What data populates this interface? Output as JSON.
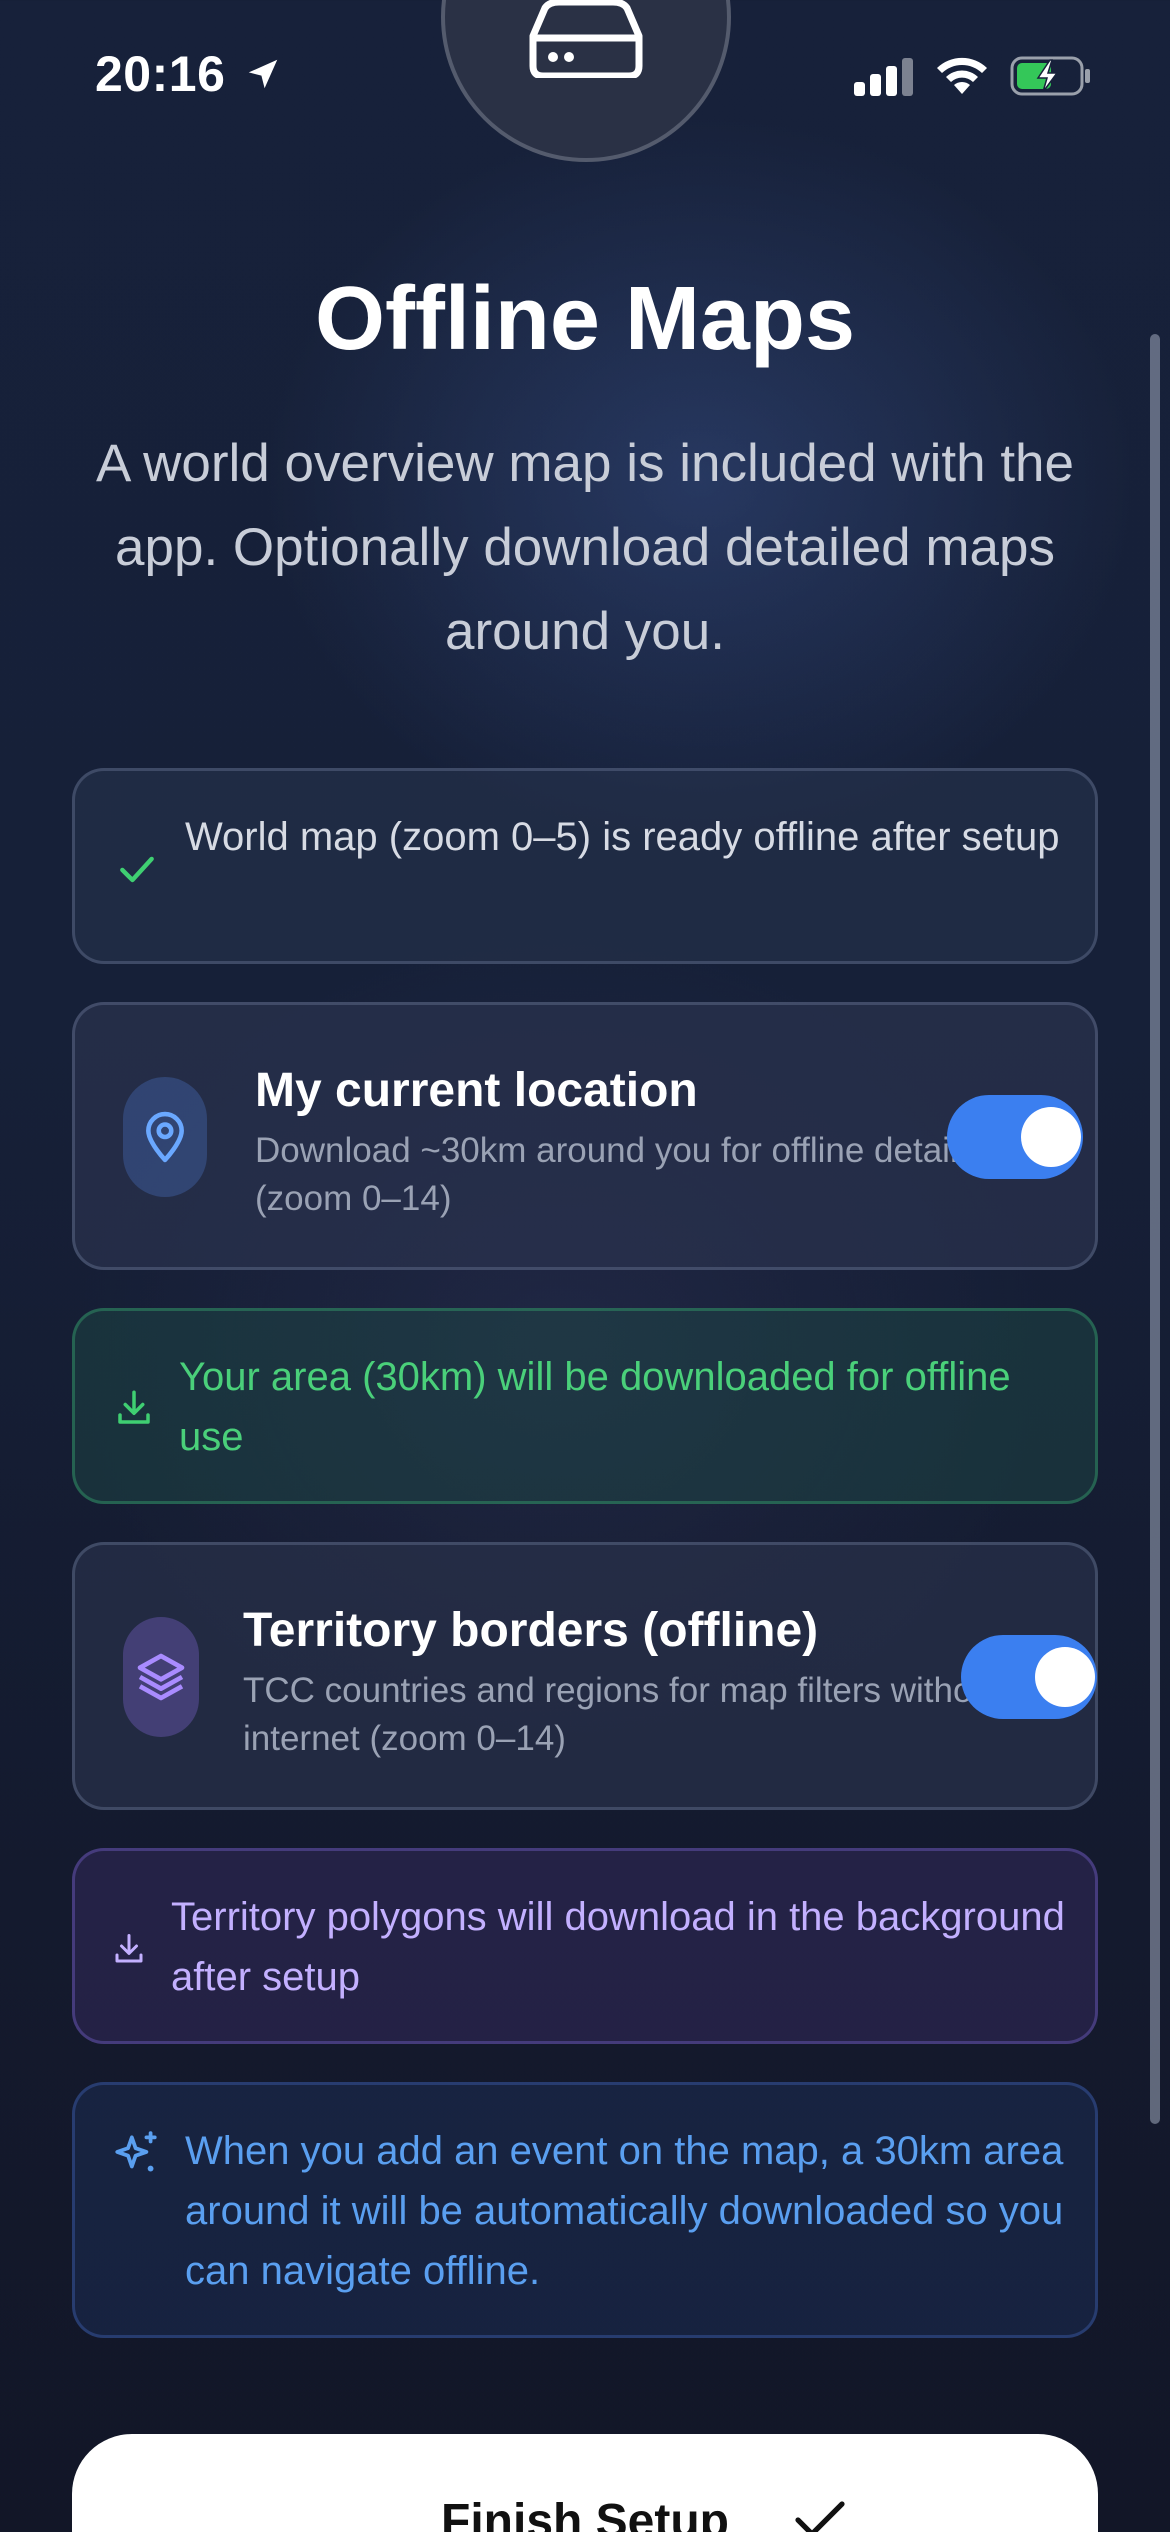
{
  "status_bar": {
    "time": "20:16",
    "icons": [
      "location-arrow-icon",
      "cellular-signal-icon",
      "wifi-icon",
      "battery-charging-icon"
    ]
  },
  "header": {
    "icon": "hard-drive-icon",
    "title": "Offline Maps",
    "subtitle": "A world overview map is included with the app. Optionally download detailed maps around you."
  },
  "world_map_notice": {
    "icon": "check-icon",
    "text": "World map (zoom 0–5) is ready offline after setup"
  },
  "current_location": {
    "icon": "map-pin-icon",
    "title": "My current location",
    "description": "Download ~30km around you for offline detail (zoom 0–14)",
    "enabled": true
  },
  "location_status": {
    "icon": "download-icon",
    "text": "Your area (30km) will be downloaded for offline use"
  },
  "territory_borders": {
    "icon": "layers-icon",
    "title": "Territory borders (offline)",
    "description": "TCC countries and regions for map filters without internet (zoom 0–14)",
    "enabled": true
  },
  "territory_status": {
    "icon": "download-icon",
    "text": "Territory polygons will download in the background after setup"
  },
  "event_info": {
    "icon": "sparkles-icon",
    "text": "When you add an event on the map, a 30km area around it will be automatically downloaded so you can navigate offline."
  },
  "finish_button": {
    "label": "Finish Setup",
    "icon": "checkmark-icon"
  },
  "colors": {
    "accent_blue": "#3b7ff0",
    "success_green": "#4ad07a",
    "purple_text": "#c3b0ff",
    "info_blue": "#5a9ff0"
  }
}
